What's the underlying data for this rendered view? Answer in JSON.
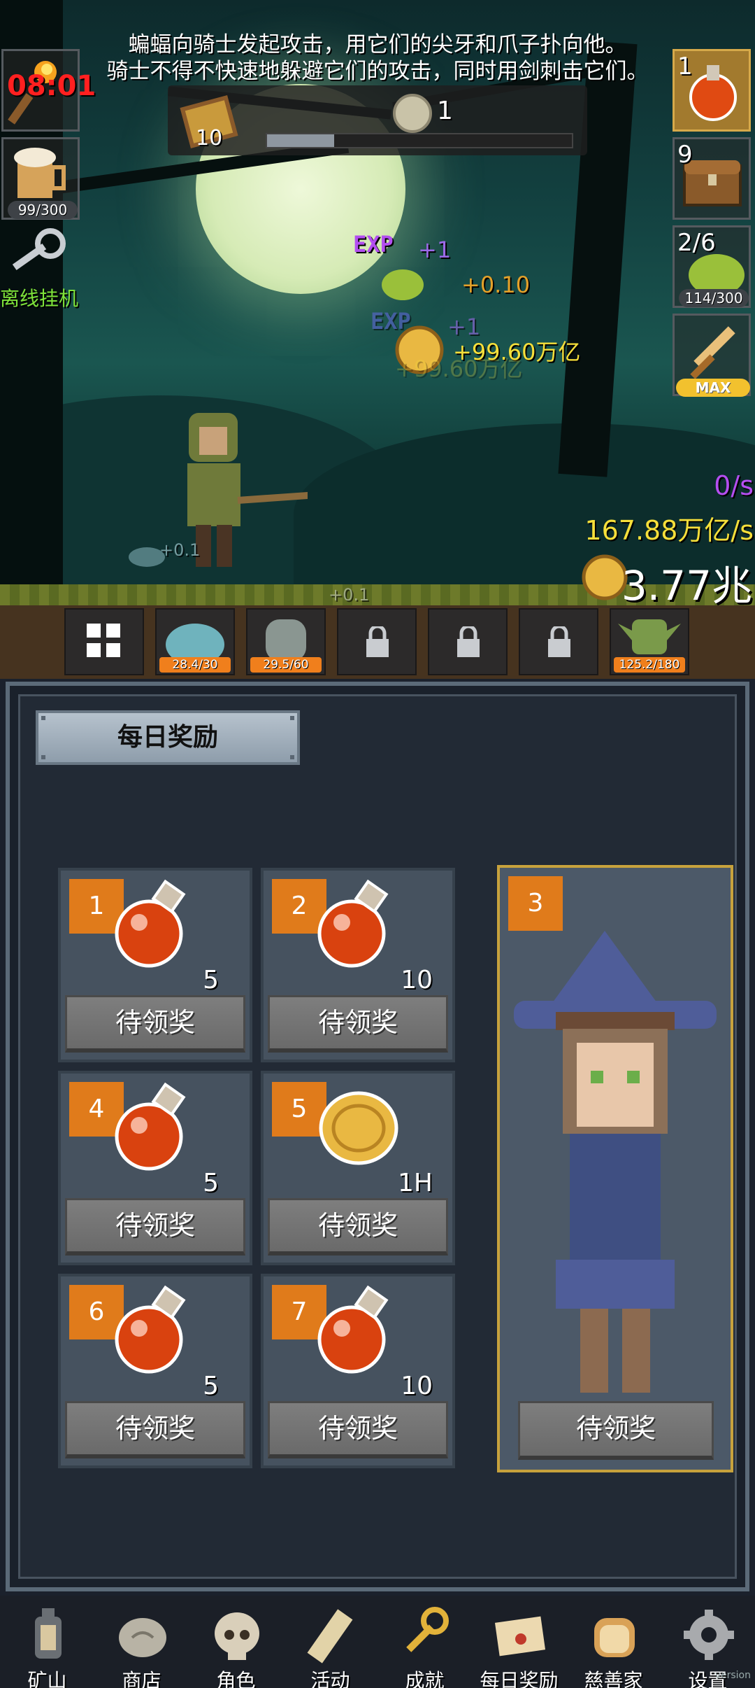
{
  "narration": {
    "line1": "蝙蝠向骑士发起攻击，用它们的尖牙和爪子扑向他。",
    "line2": "骑士不得不快速地躲避它们的攻击，同时用剑刺击它们。"
  },
  "left_sidebar": {
    "timer": "08:01",
    "mug_progress": "99/300",
    "offline_label": "离线挂机"
  },
  "top_panel": {
    "book_count": "10",
    "token_count": "1",
    "progress": 0.22
  },
  "right_sidebar": {
    "potion_count": "1",
    "chest_count": "9",
    "slime_count": "2/6",
    "slime_progress": "114/300",
    "sword_label": "MAX"
  },
  "floating": {
    "exp1": "EXP",
    "exp1_plus": "+1",
    "exp2": "EXP",
    "exp2_plus": "+1",
    "gain_small": "+0.10",
    "gain_big": "+99.60万亿",
    "gain_big_ghost": "+99.60万亿",
    "slime_plus": "+0.1",
    "ghost_plus": "+0.1"
  },
  "stats": {
    "rate_purple": "0/s",
    "rate_yellow": "167.88万亿/s",
    "gold_total": "3.77兆"
  },
  "characters": [
    {
      "name": "menu",
      "hp": ""
    },
    {
      "name": "slime",
      "hp": "28.4/30"
    },
    {
      "name": "ghost",
      "hp": "29.5/60"
    },
    {
      "name": "locked1",
      "hp": ""
    },
    {
      "name": "locked2",
      "hp": ""
    },
    {
      "name": "locked3",
      "hp": ""
    },
    {
      "name": "goblin",
      "hp": "125.2/180"
    }
  ],
  "panel": {
    "title": "每日奖励",
    "days": [
      {
        "day": "1",
        "item": "potion",
        "qty": "5",
        "button": "待领奖"
      },
      {
        "day": "2",
        "item": "potion",
        "qty": "10",
        "button": "待领奖"
      },
      {
        "day": "4",
        "item": "potion",
        "qty": "5",
        "button": "待领奖"
      },
      {
        "day": "5",
        "item": "coin",
        "qty": "1H",
        "button": "待领奖"
      },
      {
        "day": "6",
        "item": "potion",
        "qty": "5",
        "button": "待领奖"
      },
      {
        "day": "7",
        "item": "potion",
        "qty": "10",
        "button": "待领奖"
      }
    ],
    "featured": {
      "day": "3",
      "item": "witch-character",
      "button": "待领奖"
    }
  },
  "nav": [
    {
      "label": "矿山",
      "icon": "lantern-icon"
    },
    {
      "label": "商店",
      "icon": "stone-icon"
    },
    {
      "label": "角色",
      "icon": "skull-icon"
    },
    {
      "label": "活动",
      "icon": "scroll-icon"
    },
    {
      "label": "成就",
      "icon": "key-icon"
    },
    {
      "label": "每日奖励",
      "icon": "letter-icon"
    },
    {
      "label": "慈善家",
      "icon": "bread-icon"
    },
    {
      "label": "设置",
      "icon": "gear-icon"
    }
  ],
  "version": "version",
  "colors": {
    "badge": "#e07b1b",
    "gold_text": "#f6df3a",
    "exp_purple": "#b34ef0",
    "featured_border": "#c7a23c"
  }
}
